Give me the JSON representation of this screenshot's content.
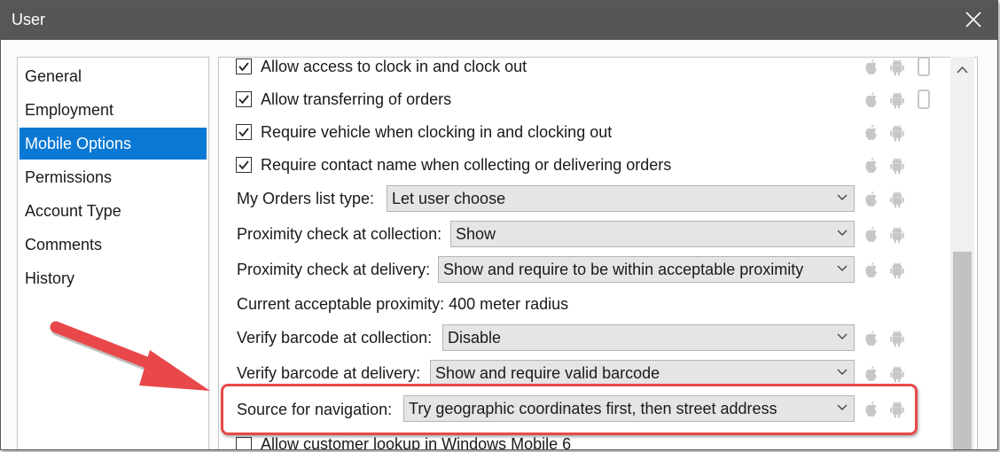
{
  "window": {
    "title": "User"
  },
  "sidebar": {
    "items": [
      {
        "label": "General"
      },
      {
        "label": "Employment"
      },
      {
        "label": "Mobile Options",
        "selected": true
      },
      {
        "label": "Permissions"
      },
      {
        "label": "Account Type"
      },
      {
        "label": "Comments"
      },
      {
        "label": "History"
      }
    ]
  },
  "options": {
    "checkboxes": [
      {
        "label": "Allow access to clock in and clock out",
        "checked": true
      },
      {
        "label": "Allow transferring of orders",
        "checked": true
      },
      {
        "label": "Require vehicle when clocking in and clocking out",
        "checked": true
      },
      {
        "label": "Require contact name when collecting or delivering orders",
        "checked": true
      }
    ],
    "orders_list_type": {
      "label": "My Orders list type:",
      "value": "Let user choose"
    },
    "proximity_collection": {
      "label": "Proximity check at collection:",
      "value": "Show"
    },
    "proximity_delivery": {
      "label": "Proximity check at delivery:",
      "value": "Show and require to be within acceptable proximity"
    },
    "current_proximity": "Current acceptable proximity: 400 meter radius",
    "barcode_collection": {
      "label": "Verify barcode at collection:",
      "value": "Disable"
    },
    "barcode_delivery": {
      "label": "Verify barcode at delivery:",
      "value": "Show and require valid barcode"
    },
    "navigation_source": {
      "label": "Source for navigation:",
      "value": "Try geographic coordinates first, then street address"
    },
    "customer_lookup": {
      "label": "Allow customer lookup in Windows Mobile 6",
      "checked": false
    }
  },
  "icons": {
    "apple": "apple-icon",
    "android": "android-icon",
    "windows_mobile": "phone-icon",
    "close": "close-icon",
    "chevron": "chevron-down-icon"
  },
  "colors": {
    "titlebar": "#565656",
    "selection": "#0b78d4",
    "highlight": "#e8484a",
    "icon_gray": "#c7c7c7"
  }
}
